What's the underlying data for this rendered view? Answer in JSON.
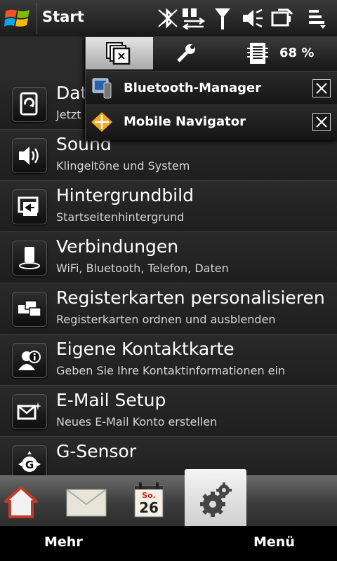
{
  "statusbar": {
    "title": "Start",
    "icons": [
      "windows-logo-icon",
      "bluetooth-off-icon",
      "data-transfer-icon",
      "signal-icon",
      "volume-icon",
      "battery-charging-icon",
      "menu-icon"
    ]
  },
  "popup": {
    "tabs": [
      "running-programs-icon",
      "settings-tool-icon",
      "battery-icon"
    ],
    "battery_percent": "68 %",
    "items": [
      {
        "label": "Bluetooth-Manager",
        "icon": "bluetooth-manager-icon"
      },
      {
        "label": "Mobile Navigator",
        "icon": "navigator-icon"
      }
    ]
  },
  "settings_list": [
    {
      "title": "Dat",
      "subtitle": "Jetzt",
      "icon": "data-sync-icon"
    },
    {
      "title": "Sound",
      "subtitle": "Klingeltöne und System",
      "icon": "speaker-icon"
    },
    {
      "title": "Hintergrundbild",
      "subtitle": "Startseitenhintergrund",
      "icon": "wallpaper-icon"
    },
    {
      "title": "Verbindungen",
      "subtitle": "WiFi, Bluetooth, Telefon, Daten",
      "icon": "connections-icon"
    },
    {
      "title": "Registerkarten personalisieren",
      "subtitle": "Registerkarten ordnen und ausblenden",
      "icon": "tabs-icon"
    },
    {
      "title": "Eigene Kontaktkarte",
      "subtitle": "Geben Sie Ihre Kontaktinformationen ein",
      "icon": "contact-card-icon"
    },
    {
      "title": "E-Mail Setup",
      "subtitle": "Neues E-Mail Konto erstellen",
      "icon": "email-setup-icon"
    },
    {
      "title": "G-Sensor",
      "subtitle": "",
      "icon": "g-sensor-icon"
    }
  ],
  "tabs": [
    {
      "name": "home-icon"
    },
    {
      "name": "mail-icon"
    },
    {
      "name": "calendar-icon",
      "day": "So.",
      "date": "26"
    },
    {
      "name": "settings-gear-icon"
    }
  ],
  "softkeys": {
    "left": "Mehr",
    "right": "Menü"
  }
}
